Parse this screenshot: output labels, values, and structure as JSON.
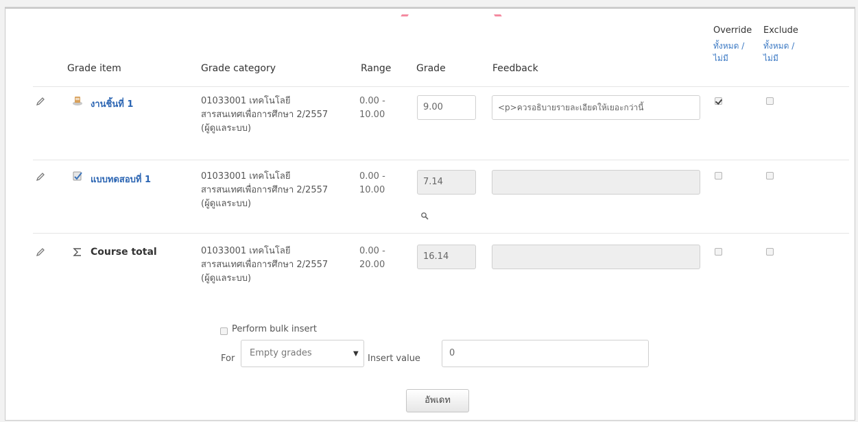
{
  "headers": {
    "grade_item": "Grade item",
    "grade_category": "Grade category",
    "range": "Range",
    "grade": "Grade",
    "feedback": "Feedback",
    "override": "Override",
    "override_links": "ทั้งหมด / ไม่มี",
    "exclude": "Exclude",
    "exclude_links": "ทั้งหมด / ไม่มี"
  },
  "rows": [
    {
      "item": "งานชิ้นที่ 1",
      "item_icon": "assignment-icon",
      "category": "01033001 เทคโนโลยีสารสนเทศเพื่อการศึกษา 2/2557 (ผู้ดูแลระบบ)",
      "range": "0.00 - 10.00",
      "grade": "9.00",
      "feedback": "<p>ควรอธิบายรายละเอียดให้เยอะกว่านี้",
      "override": true,
      "exclude": false
    },
    {
      "item": "แบบทดสอบที่ 1",
      "item_icon": "quiz-icon",
      "category": "01033001 เทคโนโลยีสารสนเทศเพื่อการศึกษา 2/2557 (ผู้ดูแลระบบ)",
      "range": "0.00 - 10.00",
      "grade": "7.14",
      "feedback": "",
      "override": false,
      "exclude": false
    },
    {
      "item": "Course total",
      "item_icon": "sigma-icon",
      "category": "01033001 เทคโนโลยีสารสนเทศเพื่อการศึกษา 2/2557 (ผู้ดูแลระบบ)",
      "range": "0.00 - 20.00",
      "grade": "16.14",
      "feedback": "",
      "override": false,
      "exclude": false
    }
  ],
  "bulk": {
    "label": "Perform bulk insert",
    "checked": false,
    "for_label": "For",
    "select_value": "Empty grades",
    "insert_label": "Insert value",
    "insert_value": "0"
  },
  "save_button": "อัพเดท",
  "colors": {
    "link": "#2a64b2",
    "disabled_bg": "#eeeeee",
    "border": "#cfcfcf"
  }
}
